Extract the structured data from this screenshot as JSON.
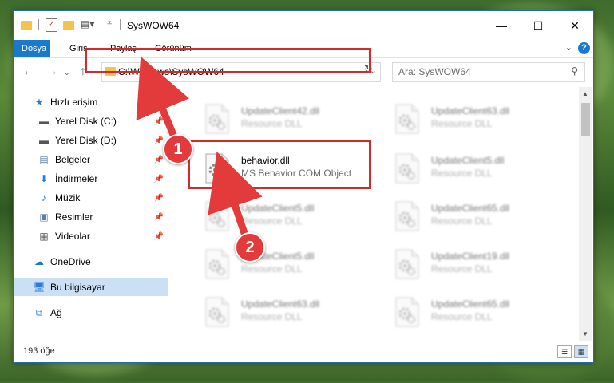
{
  "window": {
    "title": "SysWOW64"
  },
  "ribbon": {
    "tabs": [
      "Dosya",
      "Giriş",
      "Paylaş",
      "Görünüm"
    ],
    "help": "?"
  },
  "address": {
    "path": "C:\\Windows\\SysWOW64"
  },
  "search": {
    "placeholder": "Ara: SysWOW64"
  },
  "sidebar": {
    "items": [
      {
        "label": "Hızlı erişim",
        "icon": "star-icon"
      },
      {
        "label": "Yerel Disk (C:)",
        "icon": "drive-icon",
        "pinned": true
      },
      {
        "label": "Yerel Disk (D:)",
        "icon": "drive-icon",
        "pinned": true
      },
      {
        "label": "Belgeler",
        "icon": "documents-icon",
        "pinned": true
      },
      {
        "label": "İndirmeler",
        "icon": "download-icon",
        "pinned": true
      },
      {
        "label": "Müzik",
        "icon": "music-icon",
        "pinned": true
      },
      {
        "label": "Resimler",
        "icon": "pictures-icon",
        "pinned": true
      },
      {
        "label": "Videolar",
        "icon": "videos-icon",
        "pinned": true
      },
      {
        "label": "OneDrive",
        "icon": "onedrive-icon"
      },
      {
        "label": "Bu bilgisayar",
        "icon": "computer-icon",
        "selected": true
      },
      {
        "label": "Ağ",
        "icon": "network-icon"
      }
    ]
  },
  "files": {
    "left": [
      {
        "name": "UpdateClient42.dll",
        "type": "Resource DLL"
      },
      {
        "name": "behavior.dll",
        "type": "MS Behavior COM Object"
      },
      {
        "name": "UpdateClient5.dll",
        "type": "Resource DLL"
      },
      {
        "name": "UpdateClient5.dll",
        "type": "Resource DLL"
      },
      {
        "name": "UpdateClient63.dll",
        "type": "Resource DLL"
      }
    ],
    "right": [
      {
        "name": "UpdateClient63.dll",
        "type": "Resource DLL"
      },
      {
        "name": "UpdateClient5.dll",
        "type": "Resource DLL"
      },
      {
        "name": "UpdateClient65.dll",
        "type": "Resource DLL"
      },
      {
        "name": "UpdateClient19.dll",
        "type": "Resource DLL"
      },
      {
        "name": "UpdateClient65.dll",
        "type": "Resource DLL"
      }
    ]
  },
  "status": {
    "count": "193 öğe"
  },
  "annotations": {
    "step1": "1",
    "step2": "2"
  },
  "colors": {
    "accent": "#1979ca",
    "highlight": "#d62a2a",
    "selected": "#cce0f5"
  }
}
